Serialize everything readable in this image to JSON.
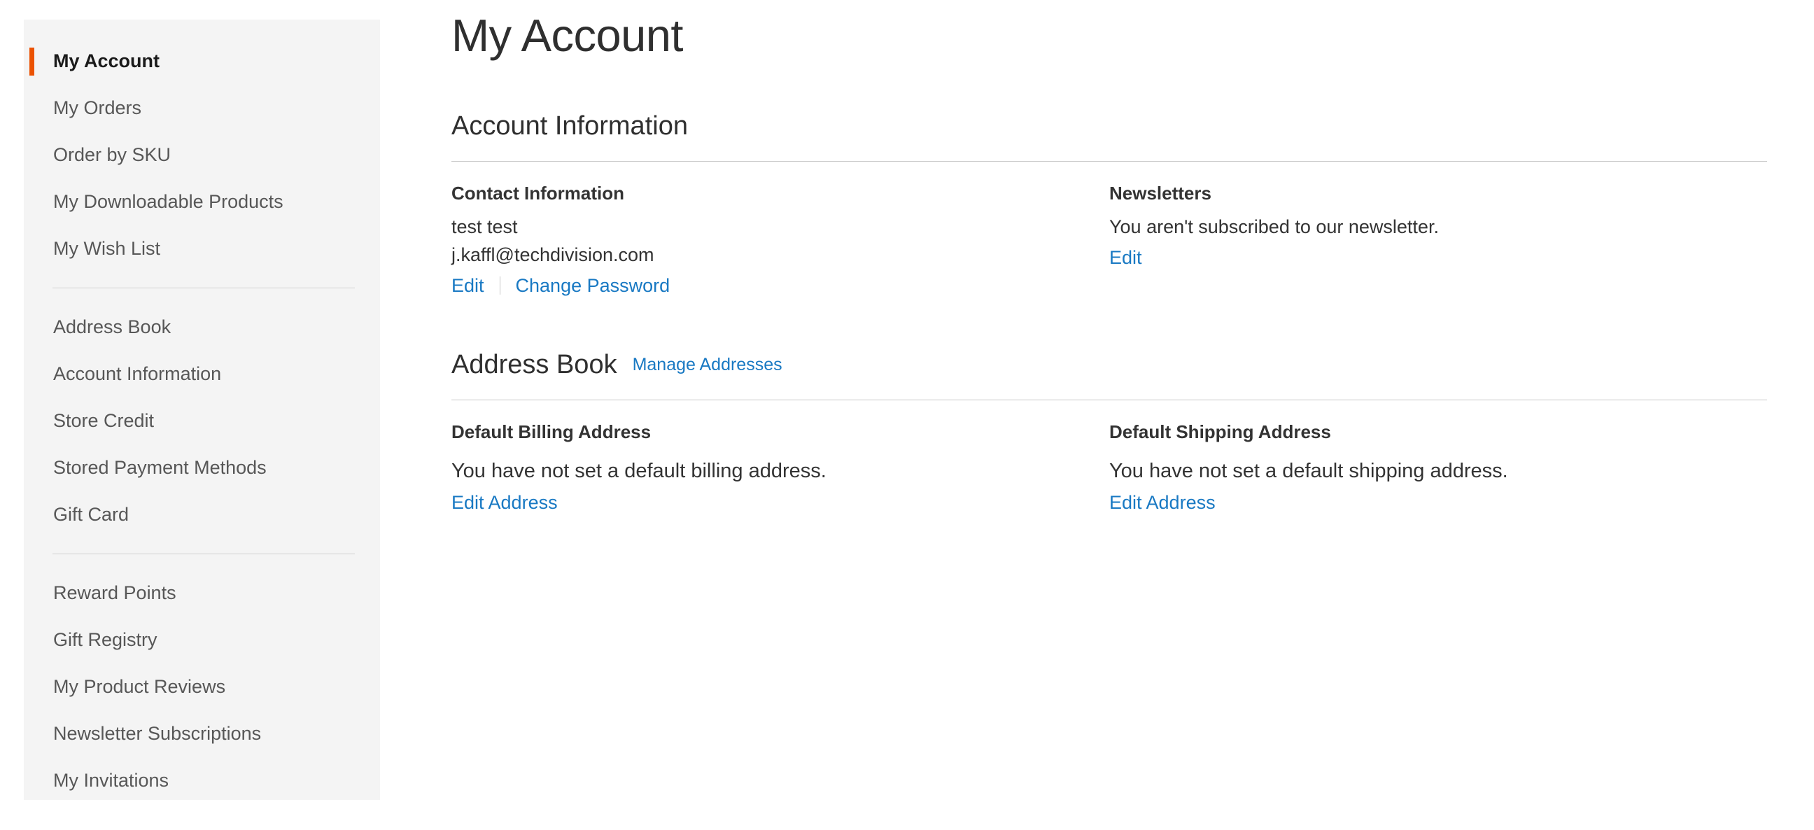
{
  "sidebar": {
    "groups": [
      {
        "items": [
          {
            "label": "My Account",
            "current": true
          },
          {
            "label": "My Orders",
            "current": false
          },
          {
            "label": "Order by SKU",
            "current": false
          },
          {
            "label": "My Downloadable Products",
            "current": false
          },
          {
            "label": "My Wish List",
            "current": false
          }
        ]
      },
      {
        "items": [
          {
            "label": "Address Book",
            "current": false
          },
          {
            "label": "Account Information",
            "current": false
          },
          {
            "label": "Store Credit",
            "current": false
          },
          {
            "label": "Stored Payment Methods",
            "current": false
          },
          {
            "label": "Gift Card",
            "current": false
          }
        ]
      },
      {
        "items": [
          {
            "label": "Reward Points",
            "current": false
          },
          {
            "label": "Gift Registry",
            "current": false
          },
          {
            "label": "My Product Reviews",
            "current": false
          },
          {
            "label": "Newsletter Subscriptions",
            "current": false
          },
          {
            "label": "My Invitations",
            "current": false
          }
        ]
      }
    ]
  },
  "main": {
    "page_title": "My Account",
    "account_information": {
      "section_title": "Account Information",
      "contact": {
        "title": "Contact Information",
        "name": "test test",
        "email": "j.kaffl@techdivision.com",
        "edit_label": "Edit",
        "change_password_label": "Change Password"
      },
      "newsletters": {
        "title": "Newsletters",
        "status": "You aren't subscribed to our newsletter.",
        "edit_label": "Edit"
      }
    },
    "address_book": {
      "section_title": "Address Book",
      "manage_label": "Manage Addresses",
      "billing": {
        "title": "Default Billing Address",
        "status": "You have not set a default billing address.",
        "edit_label": "Edit Address"
      },
      "shipping": {
        "title": "Default Shipping Address",
        "status": "You have not set a default shipping address.",
        "edit_label": "Edit Address"
      }
    }
  },
  "colors": {
    "accent": "#eb5202",
    "link": "#1979c3",
    "sidebar_bg": "#f4f4f4",
    "text": "#333333",
    "muted_text": "#575757",
    "rule": "#c6c6c6"
  }
}
